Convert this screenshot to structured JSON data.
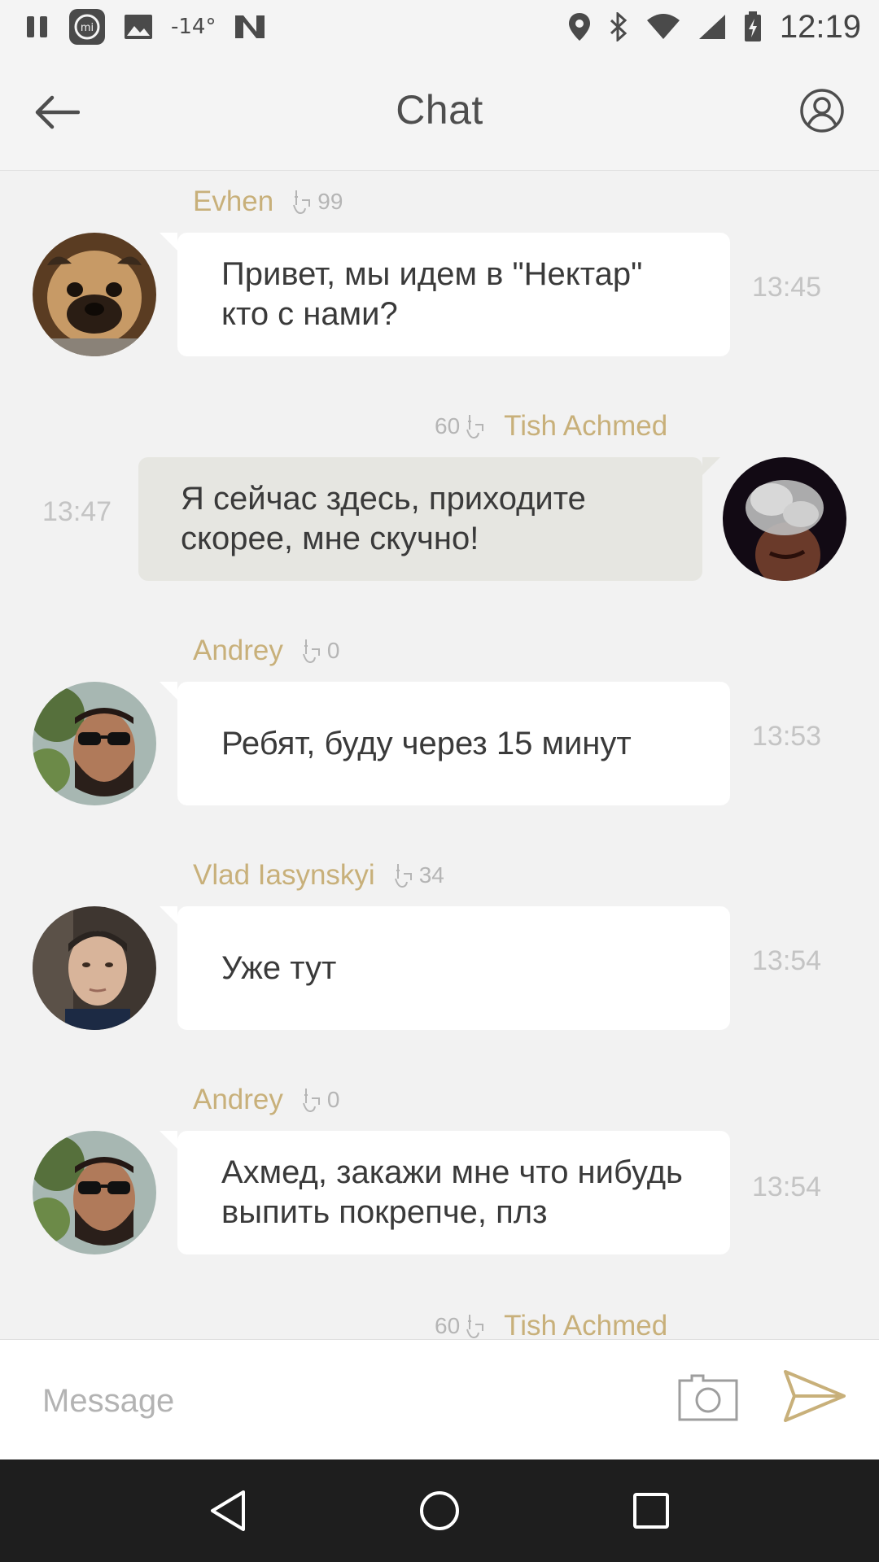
{
  "status_bar": {
    "temperature": "-14°",
    "time": "12:19",
    "icons": [
      "pause-icon",
      "mi-icon",
      "image-icon",
      "n-logo-icon",
      "location-icon",
      "bluetooth-icon",
      "wifi-icon",
      "signal-icon",
      "battery-icon"
    ]
  },
  "header": {
    "title": "Chat",
    "back_icon": "arrow-left-icon",
    "profile_icon": "user-circle-icon"
  },
  "messages": [
    {
      "author": "Evhen",
      "likes": "99",
      "text": "Привет, мы идем в \"Нектар\" кто с нами?",
      "time": "13:45",
      "direction": "incoming",
      "avatar": "pug"
    },
    {
      "author": "Tish Achmed",
      "likes": "60",
      "text": "Я сейчас здесь, приходите скорее, мне скучно!",
      "time": "13:47",
      "direction": "outgoing",
      "avatar": "smoke"
    },
    {
      "author": "Andrey",
      "likes": "0",
      "text": "Ребят, буду через 15 минут",
      "time": "13:53",
      "direction": "incoming",
      "avatar": "sunglasses"
    },
    {
      "author": "Vlad Iasynskyi",
      "likes": "34",
      "text": "Уже тут",
      "time": "13:54",
      "direction": "incoming",
      "avatar": "young-man"
    },
    {
      "author": "Andrey",
      "likes": "0",
      "text": "Ахмед, закажи мне что нибудь выпить покрепче, плз",
      "time": "13:54",
      "direction": "incoming",
      "avatar": "sunglasses"
    },
    {
      "author": "Tish Achmed",
      "likes": "60",
      "direction": "outgoing"
    }
  ],
  "composer": {
    "placeholder": "Message",
    "camera_icon": "camera-icon",
    "send_icon": "send-icon"
  },
  "nav": {
    "back_icon": "nav-back-icon",
    "home_icon": "nav-home-icon",
    "recents_icon": "nav-recents-icon"
  },
  "colors": {
    "accent": "#c8b07a",
    "background": "#f2f2f2",
    "incoming_bubble": "#ffffff",
    "outgoing_bubble": "#e6e6e1",
    "nav_bar": "#1e1e1e"
  }
}
